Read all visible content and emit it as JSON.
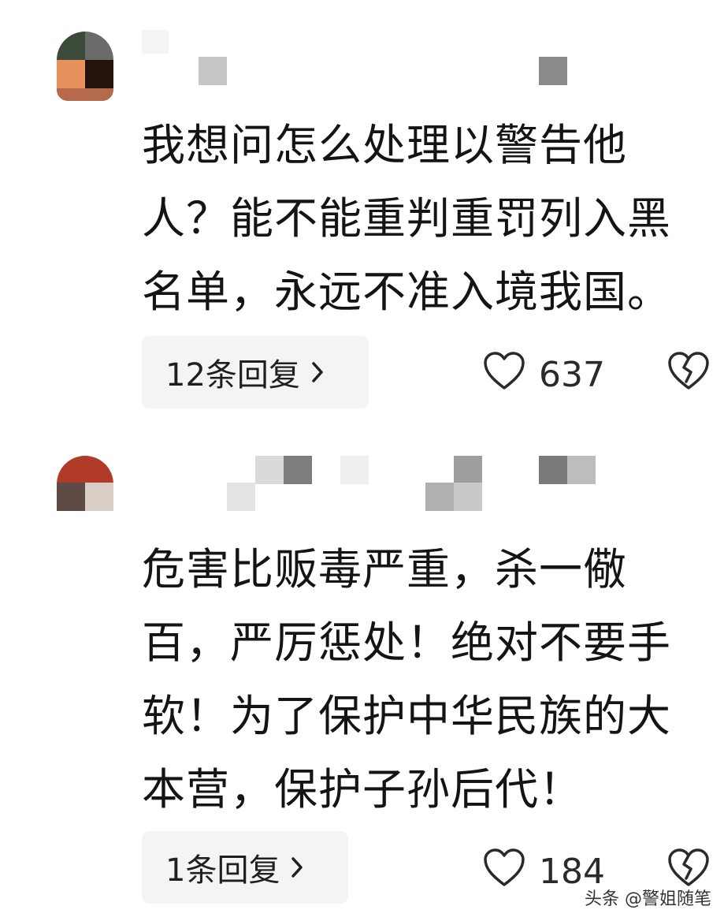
{
  "comments": [
    {
      "text_lines": [
        "我想问怎么处理以警告他",
        "人？能不能重判重罚列入黑",
        "名单，永远不准入境我国。"
      ],
      "reply_label": "12条回复",
      "like_count": "637"
    },
    {
      "text_lines": [
        "危害比贩毒严重，杀一儆",
        "百，严厉惩处！绝对不要手",
        "软！为了保护中华民族的大",
        "本营，保护子孙后代！"
      ],
      "reply_label": "1条回复",
      "like_count": "184"
    }
  ],
  "icons": {
    "like": "heart-outline-icon",
    "dislike": "broken-heart-icon",
    "reply_chevron": "chevron-right-icon"
  },
  "watermark": "头条 @警姐随笔",
  "colors": {
    "text": "#141414",
    "pill_bg": "#f4f4f5",
    "icon": "#2a2a2a"
  }
}
